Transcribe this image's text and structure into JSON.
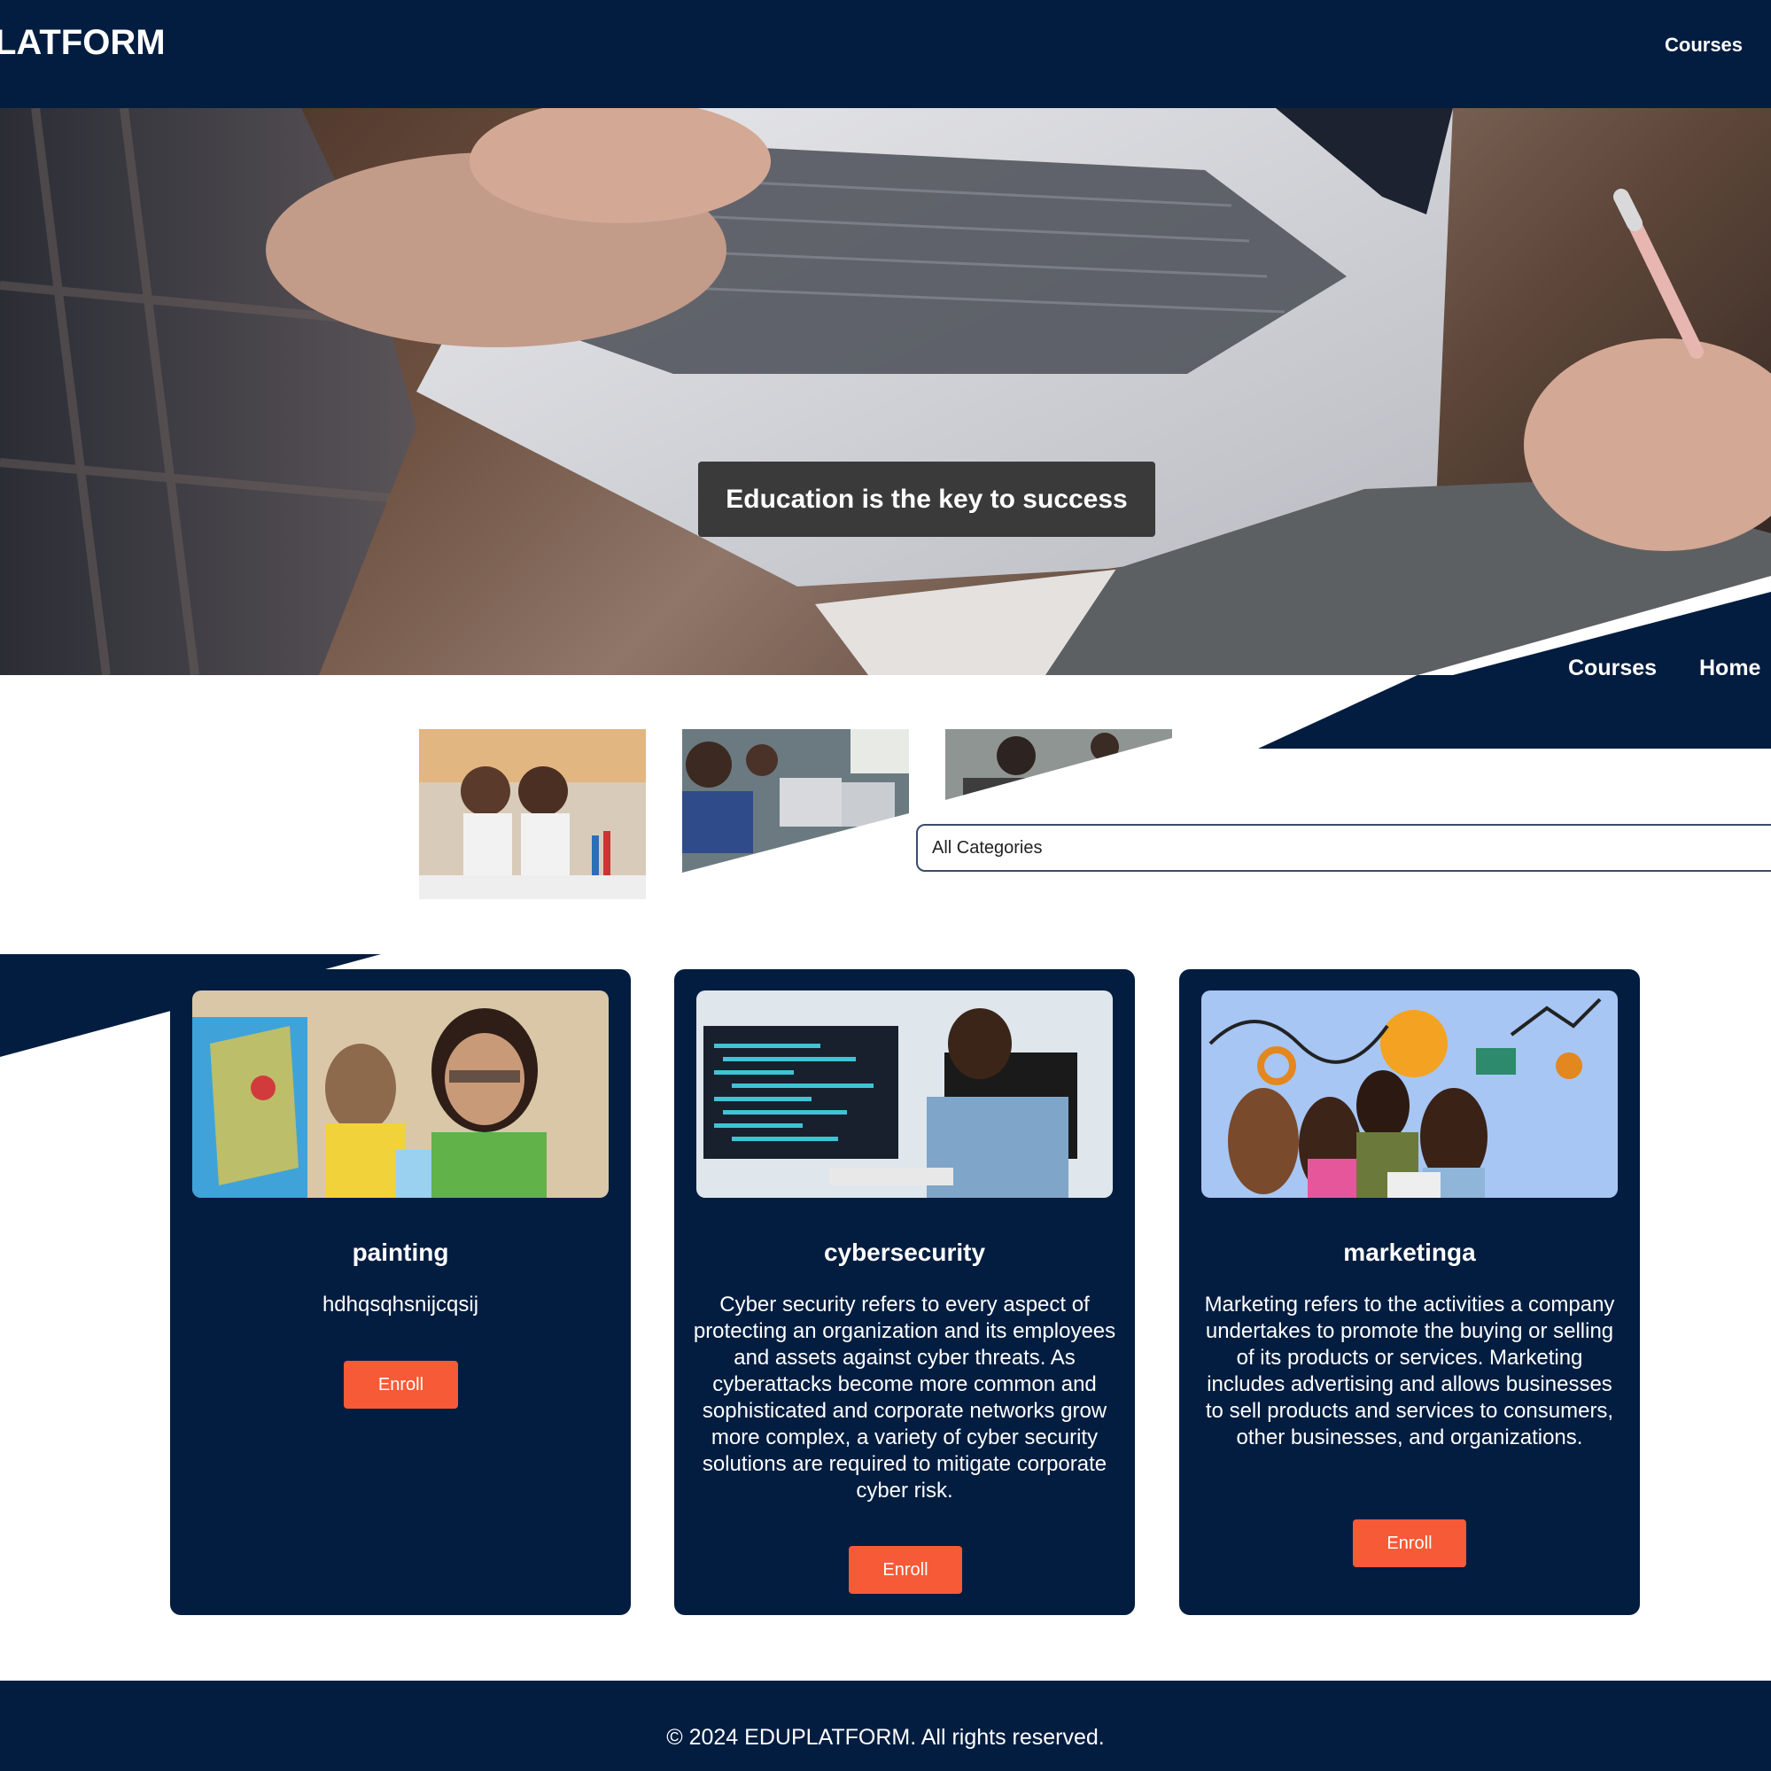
{
  "header": {
    "logo": "LATFORM",
    "nav_link": "Courses"
  },
  "hero": {
    "caption": "Education is the key to success"
  },
  "secondary_nav": {
    "items": [
      "Courses",
      "Home"
    ]
  },
  "filter": {
    "selected_category": "All Categories"
  },
  "courses": [
    {
      "title": "painting",
      "description": "hdhqsqhsnijcqsij",
      "button_label": "Enroll"
    },
    {
      "title": "cybersecurity",
      "description": "Cyber security refers to every aspect of protecting an organization and its employees and assets against cyber threats. As cyberattacks become more common and sophisticated and corporate networks grow more complex, a variety of cyber security solutions are required to mitigate corporate cyber risk.",
      "button_label": "Enroll"
    },
    {
      "title": "marketinga",
      "description": "Marketing refers to the activities a company undertakes to promote the buying or selling of its products or services. Marketing includes advertising and allows businesses to sell products and services to consumers, other businesses, and organizations.",
      "button_label": "Enroll"
    }
  ],
  "footer": {
    "text": "© 2024 EDUPLATFORM. All rights reserved."
  },
  "colors": {
    "navy": "#021d40",
    "accent": "#f75a36",
    "caption_bg": "#3a3a3a"
  }
}
